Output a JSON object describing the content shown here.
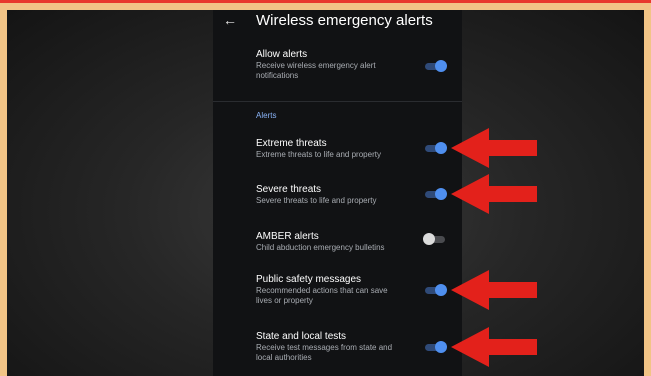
{
  "app": {
    "title": "Wireless emergency alerts",
    "back_icon": "arrow-left-icon"
  },
  "settings": {
    "allow_alerts": {
      "label": "Allow alerts",
      "description": "Receive wireless emergency alert notifications",
      "enabled": true
    },
    "section_header": "Alerts",
    "items": [
      {
        "label": "Extreme threats",
        "description": "Extreme threats to life and property",
        "enabled": true
      },
      {
        "label": "Severe threats",
        "description": "Severe threats to life and property",
        "enabled": true
      },
      {
        "label": "AMBER alerts",
        "description": "Child abduction emergency bulletins",
        "enabled": false
      },
      {
        "label": "Public safety messages",
        "description": "Recommended actions that can save lives or property",
        "enabled": true
      },
      {
        "label": "State and local tests",
        "description": "Receive test messages from state and local authorities",
        "enabled": true
      }
    ]
  },
  "colors": {
    "toggle_on": "#4f8fef",
    "toggle_off": "#dcdcdc",
    "accent_header": "#8ab4f8",
    "arrow": "#e3211b",
    "frame_border": "#f2c486"
  },
  "annotations": {
    "arrow_icon": "red-arrow-icon"
  }
}
